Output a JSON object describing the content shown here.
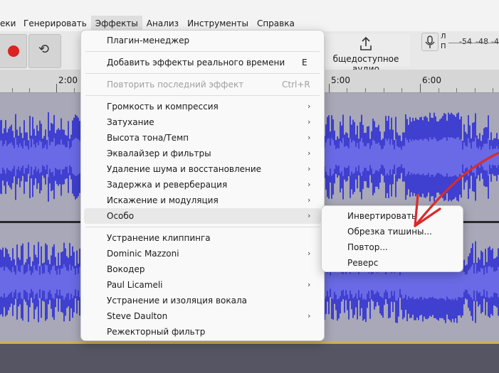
{
  "menubar": {
    "items": [
      {
        "label": "еки"
      },
      {
        "label": "Генерировать"
      },
      {
        "label": "Эффекты"
      },
      {
        "label": "Анализ"
      },
      {
        "label": "Инструменты"
      },
      {
        "label": "Справка"
      }
    ]
  },
  "toolbar": {
    "share_label": "бщедоступное аудио",
    "meter": {
      "left_channel": "Л",
      "right_channel": "П",
      "scale": [
        "-54",
        "-48",
        "-4"
      ]
    }
  },
  "ruler": {
    "labels": [
      "2:00",
      "5:00",
      "6:00"
    ]
  },
  "effects_menu": {
    "items": [
      {
        "label": "Плагин-менеджер"
      },
      {
        "label": "Добавить эффекты реального времени",
        "shortcut": "E"
      },
      {
        "label": "Повторить последний эффект",
        "shortcut": "Ctrl+R",
        "disabled": true
      },
      {
        "label": "Громкость и компрессия"
      },
      {
        "label": "Затухание"
      },
      {
        "label": "Высота тона/Темп"
      },
      {
        "label": "Эквалайзер и фильтры"
      },
      {
        "label": "Удаление шума и восстановление"
      },
      {
        "label": "Задержка и реверберация"
      },
      {
        "label": "Искажение и модуляция"
      },
      {
        "label": "Особо"
      },
      {
        "label": "Устранение клиппинга"
      },
      {
        "label": "Dominic Mazzoni"
      },
      {
        "label": "Вокодер"
      },
      {
        "label": "Paul Licameli"
      },
      {
        "label": "Устранение и изоляция вокала"
      },
      {
        "label": "Steve Daulton"
      },
      {
        "label": "Режекторный фильтр"
      }
    ]
  },
  "special_submenu": {
    "items": [
      {
        "label": "Инвертировать"
      },
      {
        "label": "Обрезка тишины..."
      },
      {
        "label": "Повтор..."
      },
      {
        "label": "Реверс"
      }
    ]
  },
  "colors": {
    "waveform": "#3f3fd0",
    "waveform_core": "#6a6ae6",
    "track_bg": "#a8a8b8",
    "annotation_arrow": "#d92b2b",
    "record": "#dd2222"
  }
}
